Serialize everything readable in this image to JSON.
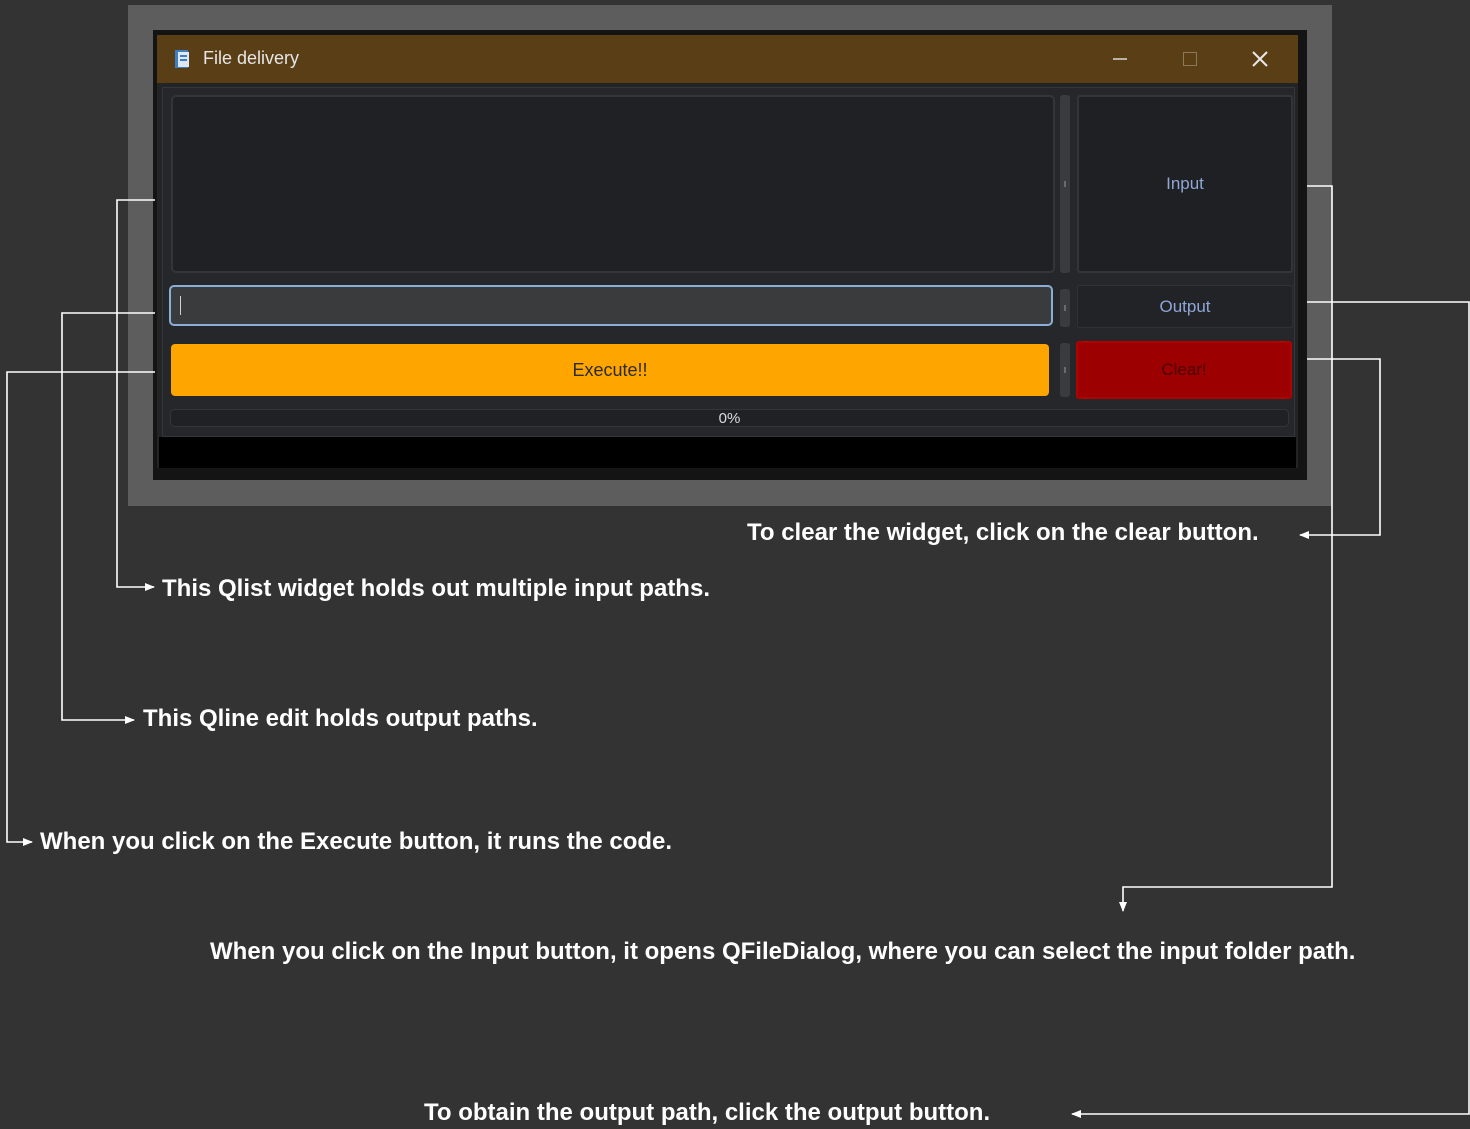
{
  "window": {
    "title": "File delivery",
    "icons": {
      "app": "folder-app-icon",
      "minimize": "minimize-icon",
      "maximize": "maximize-icon",
      "close": "close-icon"
    }
  },
  "buttons": {
    "input": "Input",
    "output": "Output",
    "execute": "Execute!!",
    "clear": "Clear!"
  },
  "progress": {
    "text": "0%",
    "value": 0
  },
  "output_field": {
    "value": ""
  },
  "annotations": {
    "clear": "To clear the widget, click on the clear button.",
    "qlist": "This Qlist widget holds out multiple input paths.",
    "qline": "This Qline edit holds output paths.",
    "execute": "When you click on the Execute button, it runs the code.",
    "input": "When you click on the Input button, it opens QFileDialog, where you can select the input folder path.",
    "output": "To obtain the output path, click the output button."
  },
  "colors": {
    "background": "#333333",
    "titlebar": "#5a3f16",
    "execute": "#ffa500",
    "clear": "#9c0000",
    "accent_text": "#8fa6d6"
  }
}
